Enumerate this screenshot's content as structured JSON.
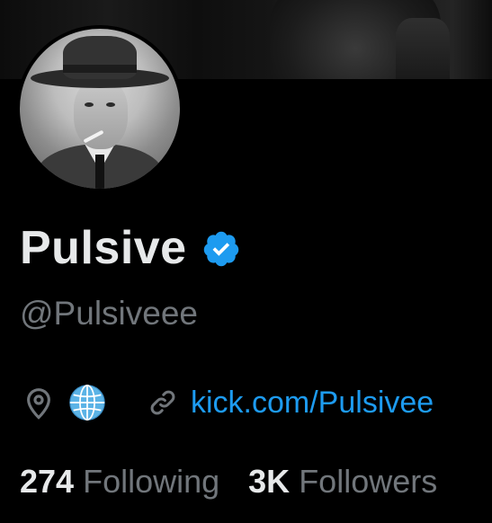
{
  "profile": {
    "display_name": "Pulsive",
    "handle": "@Pulsiveee",
    "link_text": "kick.com/Pulsivee",
    "verified_color": "#1d9bf0"
  },
  "icons": {
    "location": "location-pin-icon",
    "globe": "globe-emoji-icon",
    "link": "link-icon",
    "verified": "verified-badge-icon"
  },
  "stats": {
    "following_count": "274",
    "following_label": "Following",
    "followers_count": "3K",
    "followers_label": "Followers"
  },
  "colors": {
    "background": "#000000",
    "primary_text": "#e7e9ea",
    "secondary_text": "#71767b",
    "accent": "#1d9bf0"
  }
}
